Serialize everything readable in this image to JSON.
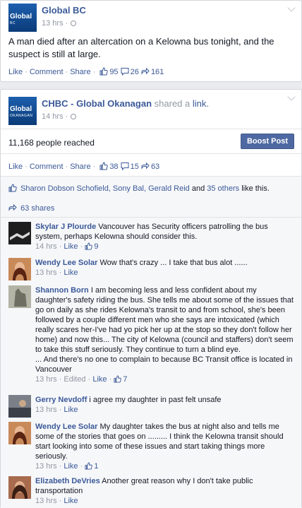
{
  "post1": {
    "page_name": "Global BC",
    "logo_text": "Global",
    "logo_sub": "BC",
    "time": "13 hrs",
    "message": "A man died after an altercation on a Kelowna bus tonight, and the suspect is still at large.",
    "like_label": "Like",
    "comment_label": "Comment",
    "share_label": "Share",
    "likes": "95",
    "comments": "26",
    "shares": "161"
  },
  "post2": {
    "page_name": "CHBC - Global Okanagan",
    "shared_text": "shared a",
    "link_text": "link.",
    "logo_text": "Global",
    "logo_sub": "OKANAGAN",
    "time": "14 hrs",
    "reach": "11,168 people reached",
    "boost_label": "Boost Post",
    "like_label": "Like",
    "comment_label": "Comment",
    "share_label": "Share",
    "likes": "38",
    "comments": "15",
    "shares": "63",
    "likers": {
      "names": "Sharon Dobson Schofield, Sony Bal, Gerald Reid",
      "and": "and",
      "others": "35 others",
      "suffix": "like this."
    },
    "share_count_text": "63 shares",
    "comments_list": [
      {
        "author": "Skylar J Plourde",
        "text": "Vancouver has Security officers patrolling the bus system, perhaps Kelowna should consider this.",
        "time": "14 hrs",
        "like": "Like",
        "likes": "9",
        "avatar_color": "#2a2a2a"
      },
      {
        "author": "Wendy Lee Solar",
        "text": "Wow that's crazy ... I take that bus alot ......",
        "time": "13 hrs",
        "like": "Like",
        "likes": "",
        "avatar_color": "#7a3b22"
      },
      {
        "author": "Shannon Born",
        "text": "I am becoming less and less confident about my daughter's safety riding the bus. She tells me about some of the issues that go on daily as she rides Kelowna's transit to and from school, she's been followed by a couple different men who she says are intoxicated (which really scares her-I've had yo pick her up at the stop so they don't follow her home) and now this... The city of Kelowna (council and staffers) don't seem to take this stuff seriously. They continue to turn a blind eye.",
        "text2": "... And there's no one to complain to because BC Transit office is located in Vancouver",
        "time": "13 hrs",
        "edited": "Edited",
        "like": "Like",
        "likes": "7",
        "avatar_color": "#8e8e80"
      },
      {
        "author": "Gerry Nevdoff",
        "text": "i agree my daughter in past felt unsafe",
        "time": "13 hrs",
        "like": "Like",
        "likes": "",
        "avatar_color": "#5b5f66"
      },
      {
        "author": "Wendy Lee Solar",
        "text": "My daughter takes the bus at night also and tells me some of the stories that goes on ......... I think the Kelowna transit should start looking into some of these issues and start taking things more seriously.",
        "time": "13 hrs",
        "like": "Like",
        "likes": "1",
        "avatar_color": "#7a3b22"
      },
      {
        "author": "Elizabeth DeVries",
        "text": "Another great reason why I don't take public transportation",
        "time": "13 hrs",
        "like": "Like",
        "likes": "",
        "avatar_color": "#6b3e2e"
      }
    ]
  },
  "colors": {
    "link_blue": "#3b5998",
    "boost_blue": "#4e69a2",
    "meta_grey": "#9197a3",
    "band_grey": "#f6f7f9"
  },
  "icons": {
    "like": "thumbs-up-icon",
    "comment": "speech-bubble-icon",
    "share": "share-arrow-icon",
    "privacy": "globe-icon",
    "menu": "chevron-down-icon"
  }
}
